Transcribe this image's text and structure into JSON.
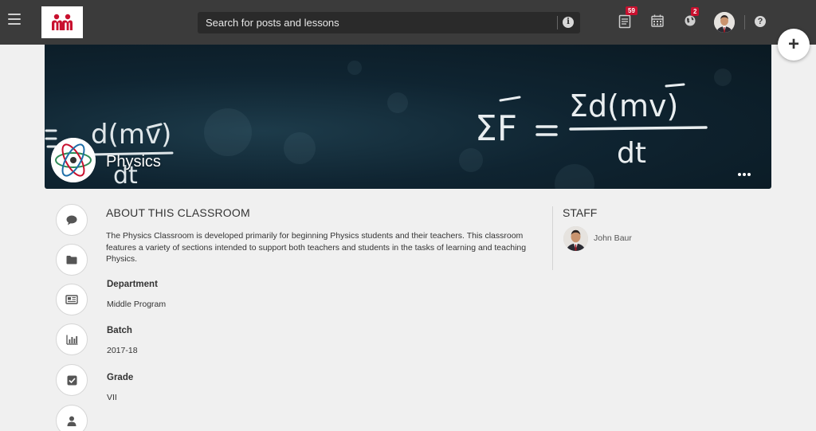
{
  "topbar": {
    "search_placeholder": "Search for posts and lessons",
    "posts_badge": "59",
    "notifications_badge": "2"
  },
  "classroom": {
    "title": "Physics"
  },
  "about": {
    "heading": "ABOUT THIS CLASSROOM",
    "description": "The Physics Classroom is developed primarily for beginning Physics students and their teachers. This classroom features a variety of sections intended to support both teachers and students in the tasks of learning and teaching Physics.",
    "fields": [
      {
        "label": "Department",
        "value": "Middle Program"
      },
      {
        "label": "Batch",
        "value": "2017-18"
      },
      {
        "label": "Grade",
        "value": "VII"
      }
    ]
  },
  "staff": {
    "heading": "STAFF",
    "members": [
      {
        "name": "John Baur"
      }
    ]
  },
  "colors": {
    "topbar": "#3b3b3b",
    "brand_red": "#c8102e",
    "badge": "#c8102e",
    "page_bg": "#f0f0f0"
  },
  "rail_icons": [
    "chat-icon",
    "folder-icon",
    "newspaper-icon",
    "bar-chart-icon",
    "checkbox-icon",
    "person-icon"
  ]
}
